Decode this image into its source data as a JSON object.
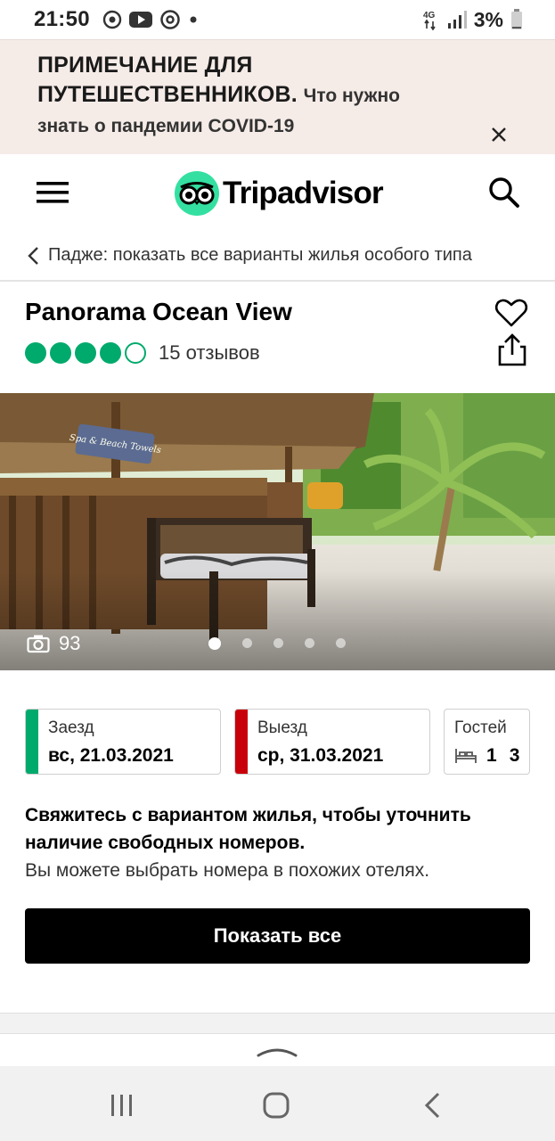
{
  "status_bar": {
    "time": "21:50",
    "network": "4G",
    "battery": "3%"
  },
  "covid_banner": {
    "title": "ПРИМЕЧАНИЕ ДЛЯ ПУТЕШЕСТВЕННИКОВ.",
    "text": "Что нужно знать о пандемии COVID-19"
  },
  "header": {
    "logo": "Tripadvisor"
  },
  "breadcrumb": {
    "label": "Падже: показать все варианты жилья особого типа"
  },
  "hotel": {
    "name": "Panorama Ocean View",
    "rating_bubbles": 4,
    "rating_max": 5,
    "reviews": "15 отзывов"
  },
  "photo": {
    "count": "93",
    "sign_text": "Spa & Beach Towels",
    "slides": 5,
    "active_slide": 1
  },
  "booking": {
    "checkin_label": "Заезд",
    "checkin_value": "вс, 21.03.2021",
    "checkout_label": "Выезд",
    "checkout_value": "ср, 31.03.2021",
    "guests_label": "Гостей",
    "rooms": "1",
    "guests": "3"
  },
  "availability": {
    "message": "Свяжитесь с вариантом жилья, чтобы уточнить наличие свободных номеров.",
    "sub": "Вы можете выбрать номера в похожих отелях."
  },
  "cta": {
    "label": "Показать все"
  },
  "colors": {
    "brand_green": "#34e0a1",
    "rating_green": "#00aa6c",
    "checkin_bar": "#00aa6c",
    "checkout_bar": "#c8000a",
    "banner_bg": "#f5ebe7"
  }
}
